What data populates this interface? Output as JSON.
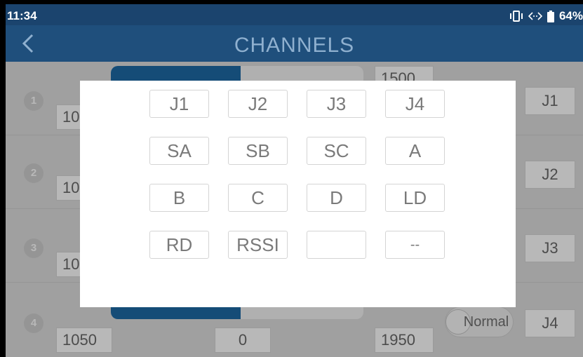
{
  "status_bar": {
    "time": "11:34",
    "battery": "64%",
    "icons": [
      "vibrate-icon",
      "data-transfer-icon",
      "battery-icon"
    ]
  },
  "app_bar": {
    "title": "CHANNELS",
    "back_icon": "chevron-left-icon"
  },
  "channels": [
    {
      "num": "1",
      "left_value": "10",
      "mid_value": "",
      "right_value": "1500",
      "assign": "J1"
    },
    {
      "num": "2",
      "left_value": "10",
      "mid_value": "",
      "right_value": "",
      "assign": "J2"
    },
    {
      "num": "3",
      "left_value": "10",
      "mid_value": "",
      "right_value": "",
      "assign": "J3"
    },
    {
      "num": "4",
      "left_value": "1050",
      "mid_value": "0",
      "right_value": "1950",
      "assign": "J4",
      "mode": "Normal"
    }
  ],
  "dialog": {
    "options": [
      "J1",
      "J2",
      "J3",
      "J4",
      "SA",
      "SB",
      "SC",
      "A",
      "B",
      "C",
      "D",
      "LD",
      "RD",
      "RSSI",
      "",
      "--"
    ]
  },
  "colors": {
    "status_bar": "#1b446e",
    "app_bar": "#1f4f7c",
    "title": "#8fb0cf",
    "bar_fill": "#1e6aa6"
  }
}
